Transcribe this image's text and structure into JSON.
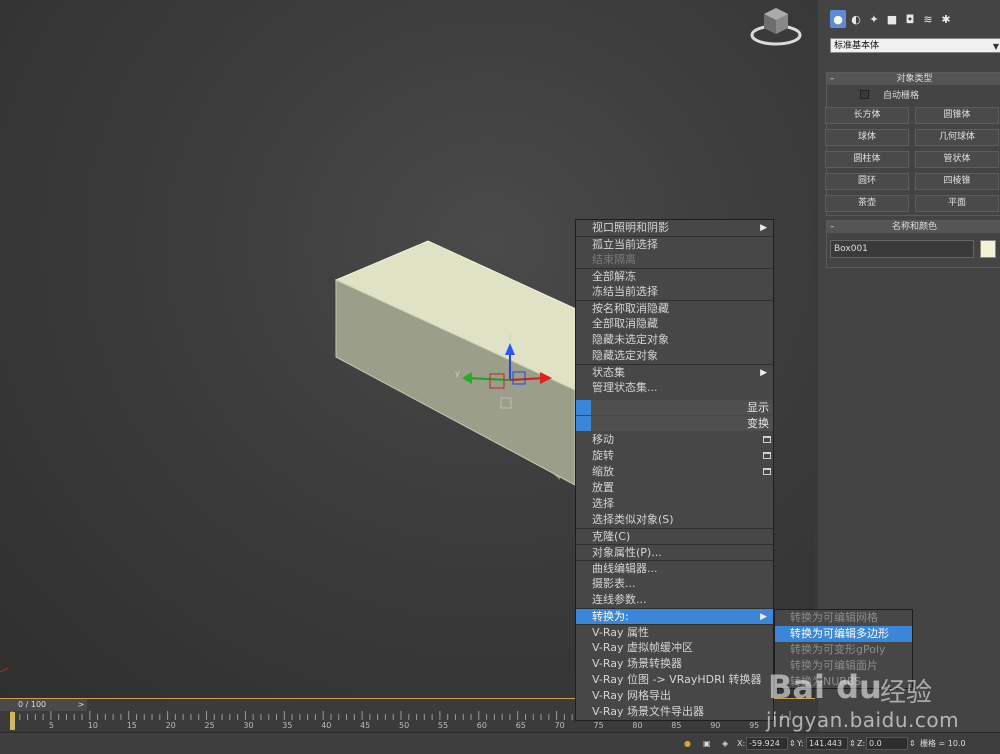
{
  "command_panel": {
    "tab_icons": [
      "sphere-icon",
      "shapes-icon",
      "lights-icon",
      "camera-icon",
      "helpers-icon",
      "spacewarps-icon",
      "systems-icon"
    ],
    "category_dropdown": "标准基本体",
    "object_type": {
      "title": "对象类型",
      "autogrid_label": "自动栅格",
      "buttons": [
        "长方体",
        "圆锥体",
        "球体",
        "几何球体",
        "圆柱体",
        "管状体",
        "圆环",
        "四棱锥",
        "茶壶",
        "平面"
      ]
    },
    "name_color": {
      "title": "名称和颜色",
      "name_value": "Box001",
      "swatch_color": "#f2f2d6"
    }
  },
  "timeline": {
    "frame_counter": "0 / 100",
    "arrow": ">",
    "ticks": [
      "0",
      "5",
      "10",
      "15",
      "20",
      "25",
      "30",
      "35",
      "40",
      "45",
      "50",
      "55",
      "60",
      "65",
      "70",
      "75",
      "80",
      "85",
      "90",
      "95"
    ]
  },
  "status_bar": {
    "x_label": "X:",
    "x_value": "-59.924",
    "y_label": "Y:",
    "y_value": "141.443",
    "z_label": "Z:",
    "z_value": "0.0",
    "grid_label": "栅格 = 10.0"
  },
  "gizmo": {
    "z_label": "z",
    "y_label": "y"
  },
  "quad_menu": {
    "items": [
      {
        "label": "视口照明和阴影",
        "sub": "▶"
      },
      {
        "label": "孤立当前选择"
      },
      {
        "label": "结束隔离",
        "disabled": true
      },
      {
        "label": "全部解冻"
      },
      {
        "label": "冻结当前选择"
      },
      {
        "label": "按名称取消隐藏"
      },
      {
        "label": "全部取消隐藏"
      },
      {
        "label": "隐藏未选定对象"
      },
      {
        "label": "隐藏选定对象"
      },
      {
        "label": "状态集",
        "sub": "▶"
      },
      {
        "label": "管理状态集..."
      }
    ],
    "header_display": "显示",
    "header_transform": "变换",
    "transform_items": [
      {
        "label": "移动",
        "check": true
      },
      {
        "label": "旋转",
        "check": true
      },
      {
        "label": "缩放",
        "check": true
      },
      {
        "label": "放置"
      },
      {
        "label": "选择"
      },
      {
        "label": "选择类似对象(S)"
      },
      {
        "label": "克隆(C)"
      },
      {
        "label": "对象属性(P)..."
      },
      {
        "label": "曲线编辑器..."
      },
      {
        "label": "摄影表..."
      },
      {
        "label": "连线参数..."
      },
      {
        "label": "转换为:",
        "sub": "▶",
        "highlight": true
      },
      {
        "label": "V-Ray 属性"
      },
      {
        "label": "V-Ray 虚拟帧缓冲区"
      },
      {
        "label": "V-Ray 场景转换器"
      },
      {
        "label": "V-Ray 位图 -> VRayHDRI 转换器"
      },
      {
        "label": "V-Ray 网格导出"
      },
      {
        "label": "V-Ray 场景文件导出器"
      }
    ]
  },
  "submenu": {
    "items": [
      {
        "label": "转换为可编辑网格"
      },
      {
        "label": "转换为可编辑多边形",
        "highlight": true
      },
      {
        "label": "转换为可变形gPoly"
      },
      {
        "label": "转换为可编辑面片"
      },
      {
        "label": "转换为NURBS"
      }
    ]
  },
  "watermark": {
    "logo": "Bai du",
    "cn": "经验",
    "url": "jingyan.baidu.com"
  },
  "colors": {
    "highlight": "#3a86d8",
    "arrow": "#e8231e",
    "box_top": "#e2e5c6",
    "box_side": "#9ea18c"
  }
}
